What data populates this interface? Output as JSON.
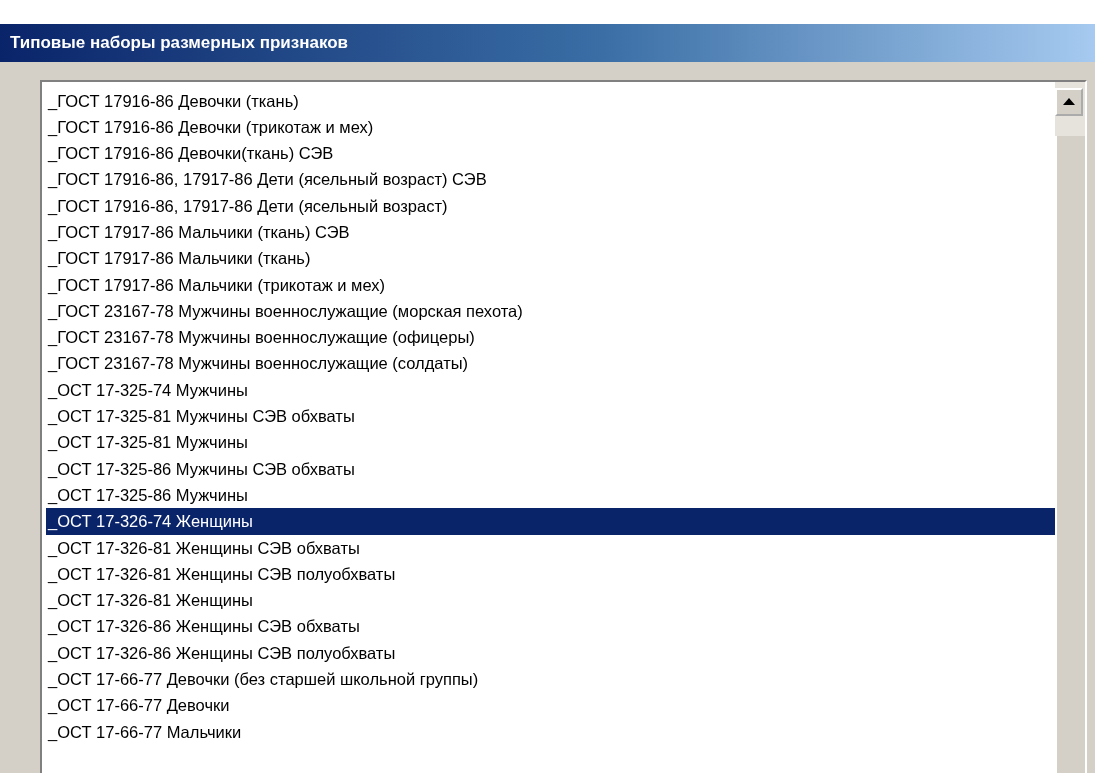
{
  "window": {
    "title": "Типовые наборы размерных признаков"
  },
  "list": {
    "items": [
      {
        "label": "_ГОСТ 17916-86 Девочки (ткань)",
        "selected": false
      },
      {
        "label": "_ГОСТ 17916-86 Девочки (трикотаж и мех)",
        "selected": false
      },
      {
        "label": "_ГОСТ 17916-86 Девочки(ткань) СЭВ",
        "selected": false
      },
      {
        "label": "_ГОСТ 17916-86, 17917-86 Дети (ясельный возраст) СЭВ",
        "selected": false
      },
      {
        "label": "_ГОСТ 17916-86, 17917-86 Дети (ясельный возраст)",
        "selected": false
      },
      {
        "label": "_ГОСТ 17917-86 Мальчики (ткань) СЭВ",
        "selected": false
      },
      {
        "label": "_ГОСТ 17917-86 Мальчики (ткань)",
        "selected": false
      },
      {
        "label": "_ГОСТ 17917-86 Мальчики (трикотаж и мех)",
        "selected": false
      },
      {
        "label": "_ГОСТ 23167-78 Мужчины военнослужащие (морская пехота)",
        "selected": false
      },
      {
        "label": "_ГОСТ 23167-78 Мужчины военнослужащие (офицеры)",
        "selected": false
      },
      {
        "label": "_ГОСТ 23167-78 Мужчины военнослужащие (солдаты)",
        "selected": false
      },
      {
        "label": "_ОСТ 17-325-74 Мужчины",
        "selected": false
      },
      {
        "label": "_ОСТ 17-325-81 Мужчины СЭВ обхваты",
        "selected": false
      },
      {
        "label": "_ОСТ 17-325-81 Мужчины",
        "selected": false
      },
      {
        "label": "_ОСТ 17-325-86 Мужчины СЭВ обхваты",
        "selected": false
      },
      {
        "label": "_ОСТ 17-325-86 Мужчины",
        "selected": false
      },
      {
        "label": "_ОСТ 17-326-74 Женщины",
        "selected": true
      },
      {
        "label": "_ОСТ 17-326-81 Женщины СЭВ обхваты",
        "selected": false
      },
      {
        "label": "_ОСТ 17-326-81 Женщины СЭВ полуобхваты",
        "selected": false
      },
      {
        "label": "_ОСТ 17-326-81 Женщины",
        "selected": false
      },
      {
        "label": "_ОСТ 17-326-86 Женщины СЭВ обхваты",
        "selected": false
      },
      {
        "label": "_ОСТ 17-326-86 Женщины СЭВ полуобхваты",
        "selected": false
      },
      {
        "label": "_ОСТ 17-66-77 Девочки (без старшей школьной группы)",
        "selected": false
      },
      {
        "label": "_ОСТ 17-66-77 Девочки",
        "selected": false
      },
      {
        "label": "_ОСТ 17-66-77 Мальчики",
        "selected": false
      }
    ]
  }
}
